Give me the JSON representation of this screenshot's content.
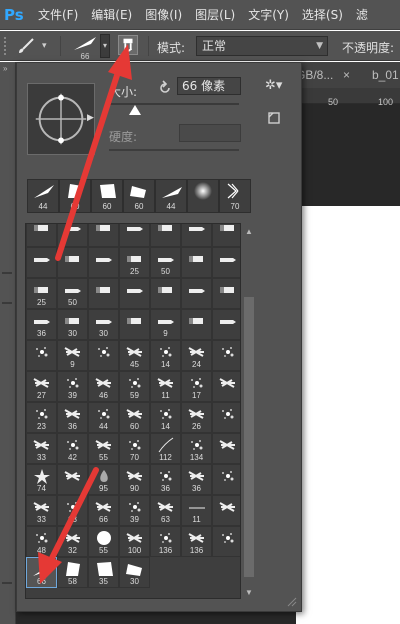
{
  "app": {
    "logo": "Ps"
  },
  "menu": [
    "文件(F)",
    "编辑(E)",
    "图像(I)",
    "图层(L)",
    "文字(Y)",
    "选择(S)",
    "滤"
  ],
  "options_bar": {
    "brush_size": "66",
    "mode_label": "模式:",
    "mode_value": "正常",
    "opacity_label": "不透明度:"
  },
  "document": {
    "tab1": "GB/8...",
    "tab1_close": "×",
    "tab2": "b_01",
    "ruler_nums": [
      "50",
      "100"
    ]
  },
  "picker": {
    "size_label": "大小:",
    "size_value": "66 像素",
    "size_fraction": 0.2,
    "hardness_label": "硬度:",
    "recent": [
      "44",
      "60",
      "60",
      "60",
      "44",
      "",
      "70"
    ],
    "grid_rows": [
      [
        "",
        "",
        "",
        "",
        "",
        "",
        ""
      ],
      [
        "",
        "",
        "",
        "25",
        "50",
        "",
        ""
      ],
      [
        "25",
        "50",
        "",
        "",
        "",
        "",
        ""
      ],
      [
        "36",
        "30",
        "30",
        "",
        "9",
        "",
        ""
      ],
      [
        "",
        "9",
        "",
        "45",
        "14",
        "24",
        ""
      ],
      [
        "27",
        "39",
        "46",
        "59",
        "11",
        "17",
        ""
      ],
      [
        "23",
        "36",
        "44",
        "60",
        "14",
        "26",
        ""
      ],
      [
        "33",
        "42",
        "55",
        "70",
        "112",
        "134",
        ""
      ],
      [
        "74",
        "",
        "95",
        "90",
        "36",
        "36",
        ""
      ],
      [
        "33",
        "63",
        "66",
        "39",
        "63",
        "11",
        ""
      ],
      [
        "48",
        "32",
        "55",
        "100",
        "136",
        "136",
        ""
      ],
      [
        "66",
        "58",
        "35",
        "30",
        "",
        "",
        ""
      ]
    ]
  }
}
